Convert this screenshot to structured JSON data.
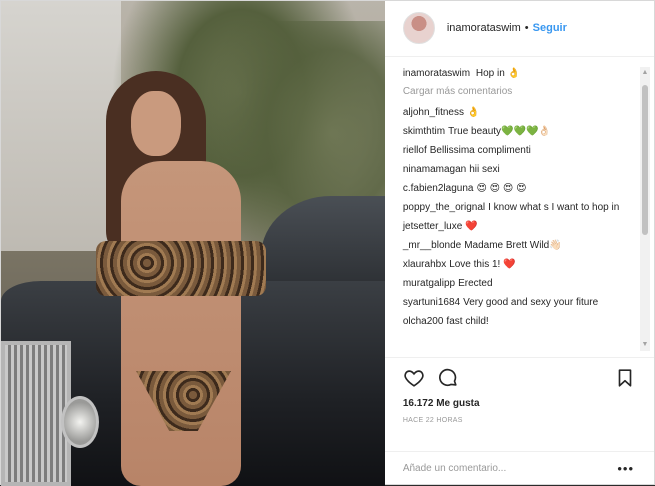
{
  "header": {
    "username": "inamorataswim",
    "separator": "•",
    "follow_label": "Seguir"
  },
  "caption": {
    "user": "inamorataswim",
    "text": "Hop in 👌"
  },
  "load_more_label": "Cargar más comentarios",
  "comments": [
    {
      "user": "aljohn_fitness",
      "text": "👌"
    },
    {
      "user": "skimthtim",
      "text": "True beauty💚💚💚👌🏻"
    },
    {
      "user": "riellof",
      "text": "Bellissima complimenti"
    },
    {
      "user": "ninamamagan",
      "text": "hii sexi"
    },
    {
      "user": "c.fabien2laguna",
      "text": "😍 😍 😍 😍"
    },
    {
      "user": "poppy_the_orignal",
      "text": "I know what s I want to hop in"
    },
    {
      "user": "jetsetter_luxe",
      "text": "❤️"
    },
    {
      "user": "_mr__blonde",
      "text": "Madame Brett Wild👋🏻"
    },
    {
      "user": "xlaurahbx",
      "text": "Love this 1! ❤️"
    },
    {
      "user": "muratgalipp",
      "text": "Erected"
    },
    {
      "user": "syartuni1684",
      "text": "Very good and sexy your fiture"
    },
    {
      "user": "olcha200",
      "text": "fast child!"
    }
  ],
  "likes": "16.172 Me gusta",
  "time_ago": "HACE 22 HORAS",
  "add_comment_placeholder": "Añade un comentario...",
  "more_label": "•••",
  "icons": [
    "heart-icon",
    "comment-icon",
    "bookmark-icon"
  ],
  "colors": {
    "follow": "#3897f0",
    "text": "#262626",
    "muted": "#999999"
  }
}
